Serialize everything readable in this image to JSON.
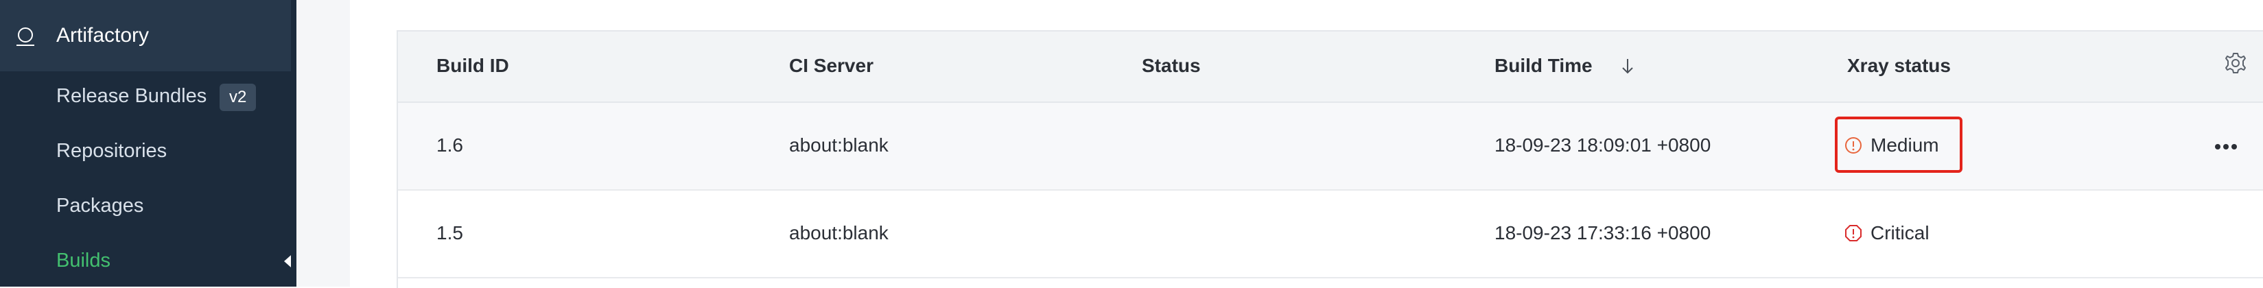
{
  "sidebar": {
    "app_title": "Artifactory",
    "items": [
      {
        "label": "Release Bundles",
        "badge": "v2"
      },
      {
        "label": "Repositories"
      },
      {
        "label": "Packages"
      },
      {
        "label": "Builds",
        "active": true
      }
    ],
    "active_color": "#43c06f"
  },
  "table": {
    "columns": [
      "Build ID",
      "CI Server",
      "Status",
      "Build Time",
      "Xray status"
    ],
    "sorted_column": "Build Time",
    "sort_direction": "descending",
    "rows": [
      {
        "build_id": "1.6",
        "ci_server": "about:blank",
        "status": "",
        "build_time": "18-09-23 18:09:01 +0800",
        "xray_status": "Medium",
        "xray_color": "#e8663d",
        "highlighted": true
      },
      {
        "build_id": "1.5",
        "ci_server": "about:blank",
        "status": "",
        "build_time": "18-09-23 17:33:16 +0800",
        "xray_status": "Critical",
        "xray_color": "#d92b2b"
      }
    ],
    "icons": {
      "settings": "gear-icon",
      "row_actions": "more-horizontal-icon",
      "sort": "arrow-down-icon"
    }
  }
}
